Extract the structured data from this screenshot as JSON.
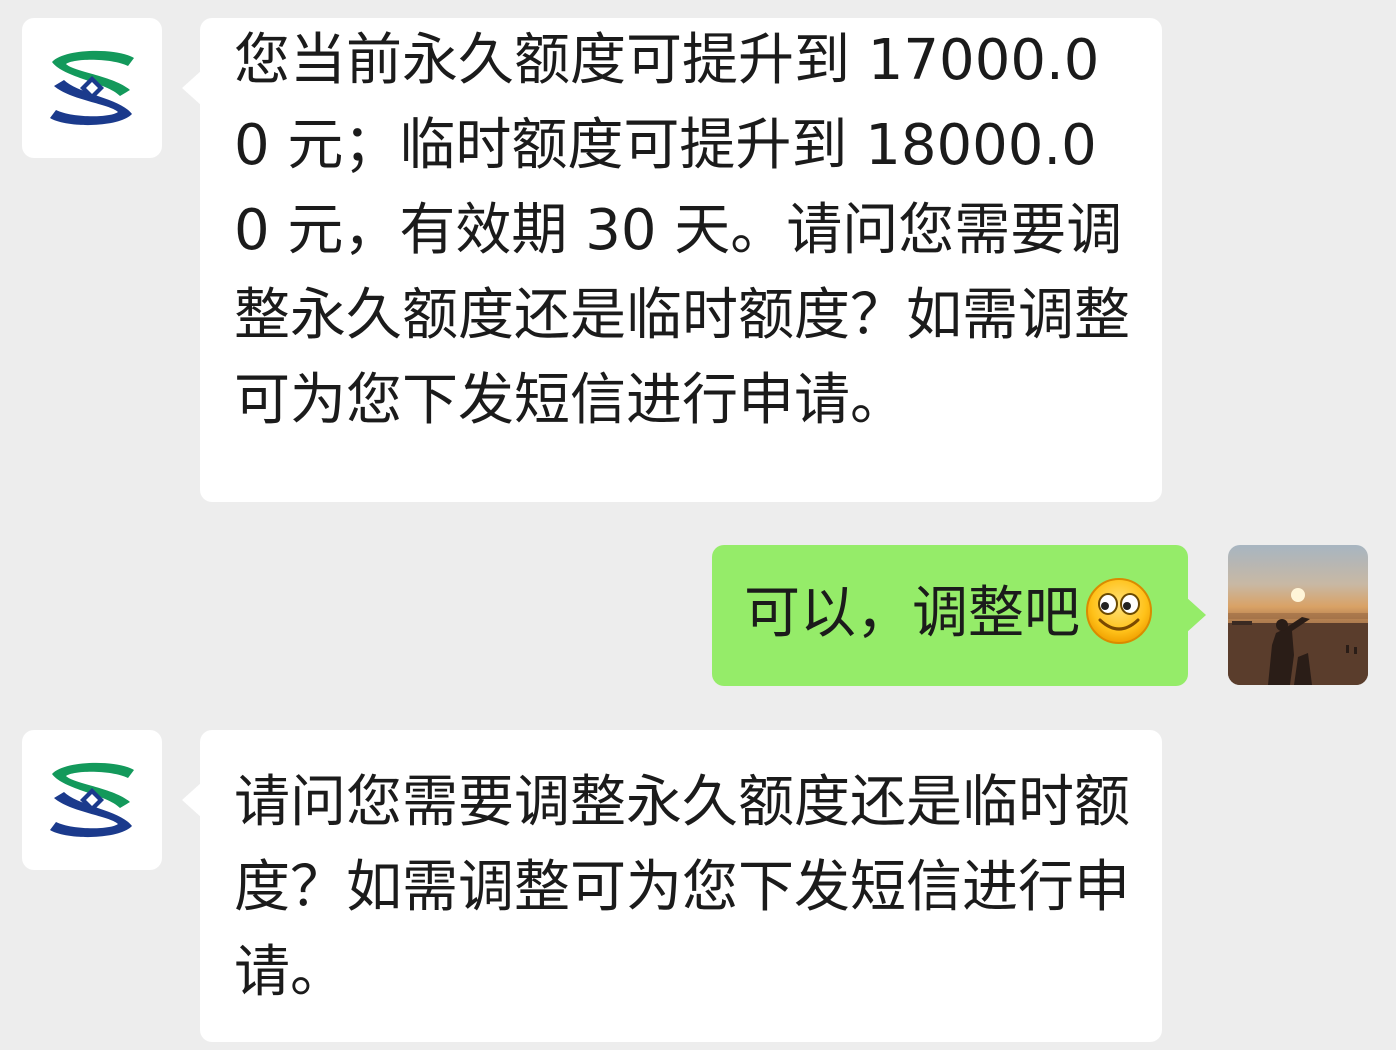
{
  "colors": {
    "background": "#ededed",
    "incoming_bubble": "#ffffff",
    "outgoing_bubble": "#95ec69",
    "bank_logo_green": "#13995b",
    "bank_logo_blue": "#1b3a8c"
  },
  "messages": [
    {
      "sender": "bank",
      "avatar_icon": "bank-logo-icon",
      "text": "您当前永久额度可提升到 17000.00 元；临时额度可提升到 18000.00 元，有效期 30 天。请问您需要调整永久额度还是临时额度？如需调整可为您下发短信进行申请。"
    },
    {
      "sender": "user",
      "avatar_icon": "sunset-photo-avatar",
      "text": "可以，调整吧",
      "emoji": "grinning-face-emoji"
    },
    {
      "sender": "bank",
      "avatar_icon": "bank-logo-icon",
      "text": "请问您需要调整永久额度还是临时额度？如需调整可为您下发短信进行申请。"
    }
  ]
}
